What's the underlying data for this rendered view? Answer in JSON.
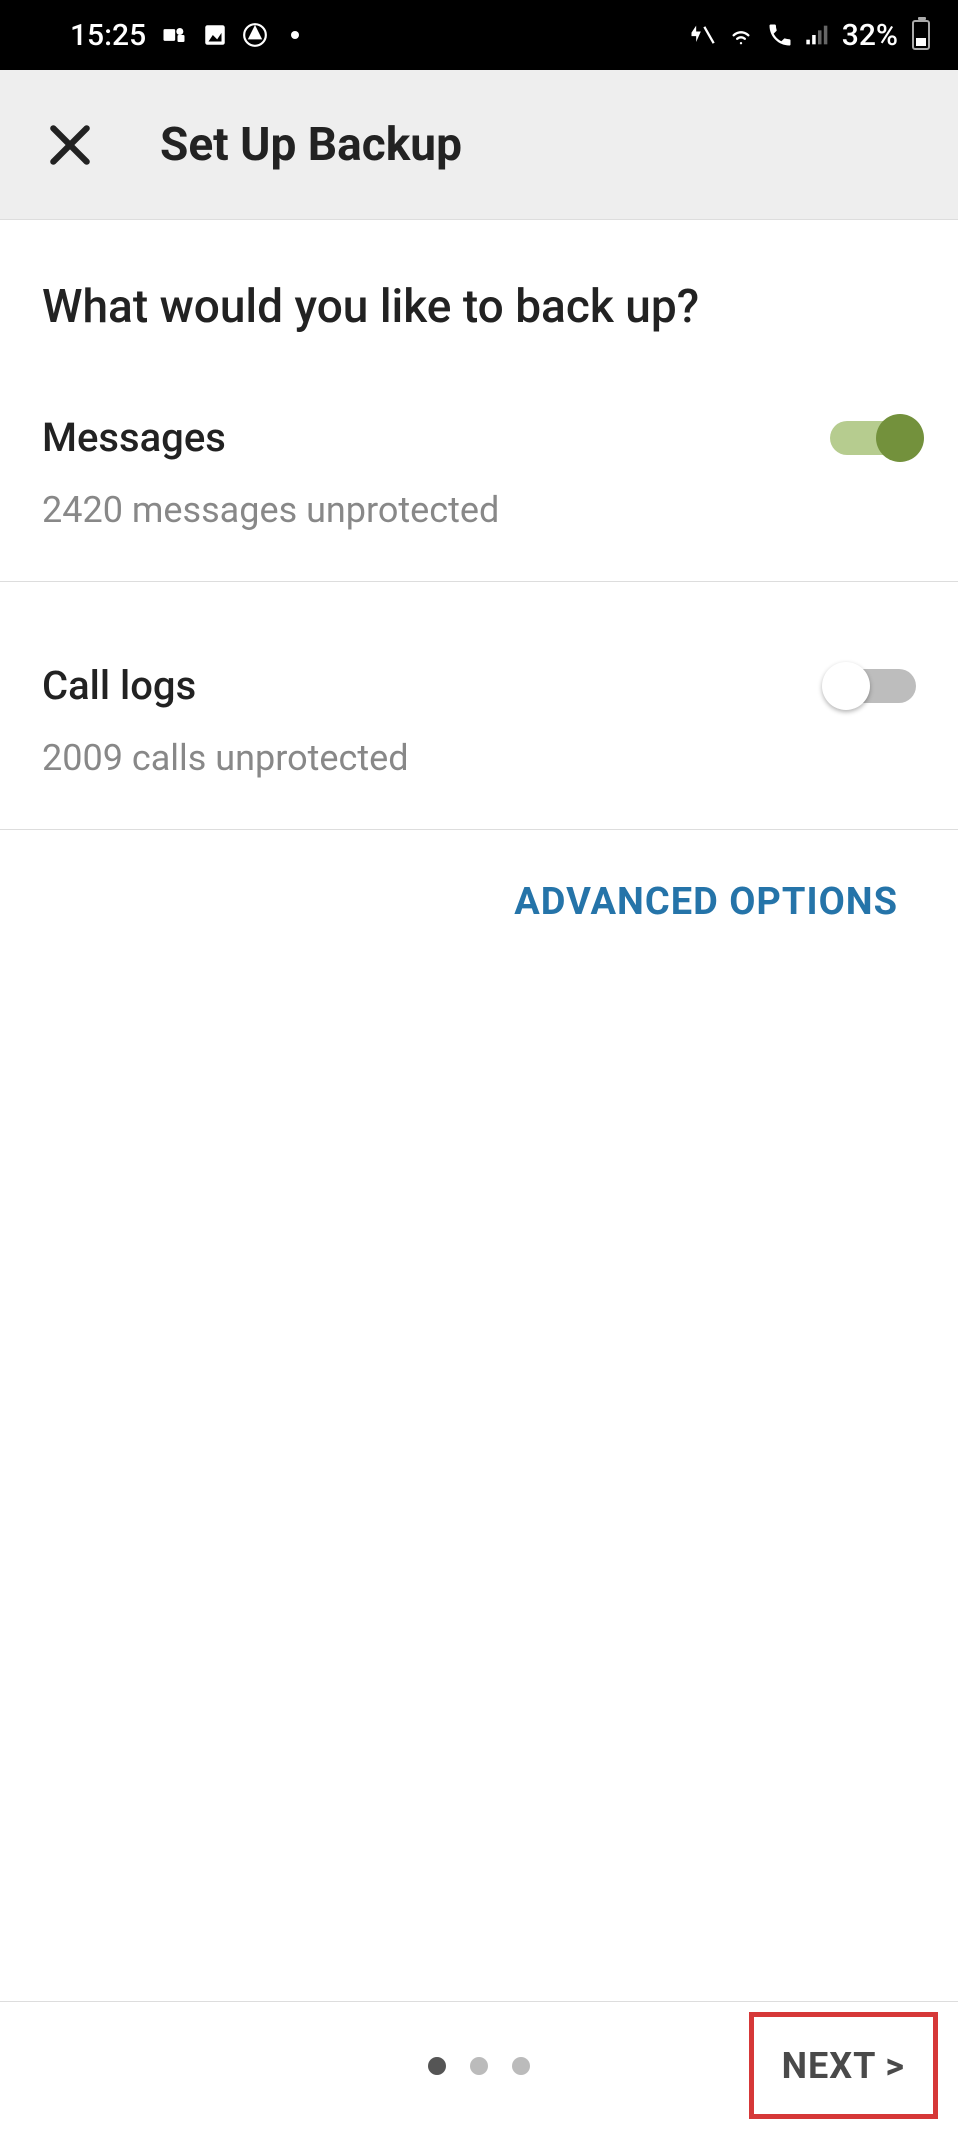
{
  "statusBar": {
    "time": "15:25",
    "battery": "32%"
  },
  "appBar": {
    "title": "Set Up Backup"
  },
  "main": {
    "question": "What would you like to back up?",
    "options": [
      {
        "title": "Messages",
        "subtitle": "2420 messages unprotected",
        "enabled": true
      },
      {
        "title": "Call logs",
        "subtitle": "2009 calls unprotected",
        "enabled": false
      }
    ],
    "advancedLabel": "ADVANCED OPTIONS"
  },
  "footer": {
    "activeDot": 0,
    "totalDots": 3,
    "nextLabel": "NEXT >"
  }
}
